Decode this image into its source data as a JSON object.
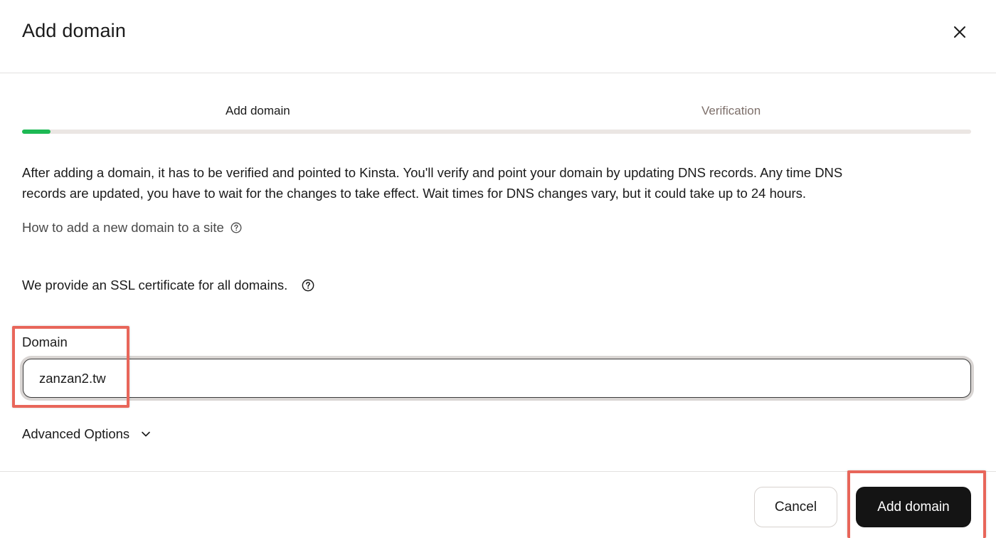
{
  "modal": {
    "title": "Add domain",
    "close_icon": "close-icon"
  },
  "steps": {
    "items": [
      {
        "label": "Add domain",
        "state": "active"
      },
      {
        "label": "Verification",
        "state": "inactive"
      }
    ],
    "progress_fraction": 0.03,
    "progress_color": "#1db954"
  },
  "content": {
    "intro_line1": "After adding a domain, it has to be verified and pointed to Kinsta. You'll verify and point your domain by updating DNS records. Any time DNS",
    "intro_line2": "records are updated, you have to wait for the changes to take effect. Wait times for DNS changes vary, but it could take up to 24 hours.",
    "help_link": "How to add a new domain to a site",
    "help_icon": "question-circle-icon",
    "ssl_text": "We provide an SSL certificate for all domains.",
    "ssl_icon": "question-circle-icon"
  },
  "form": {
    "domain_label": "Domain",
    "domain_value": "zanzan2.tw",
    "advanced_options_label": "Advanced Options",
    "advanced_icon": "chevron-down-icon"
  },
  "footer": {
    "cancel_label": "Cancel",
    "submit_label": "Add domain"
  },
  "colors": {
    "primary_button": "#141414",
    "highlight_annotation": "#e8665a",
    "inactive_step": "#7d6f6a"
  }
}
